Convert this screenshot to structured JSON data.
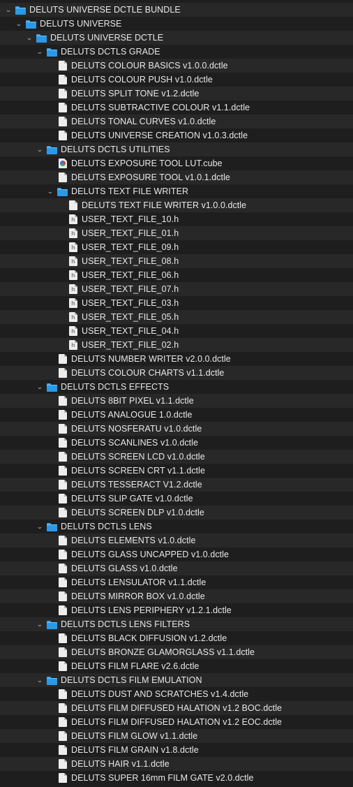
{
  "tree": [
    {
      "depth": 0,
      "type": "folder",
      "expanded": true,
      "label": "DELUTS UNIVERSE DCTLE BUNDLE",
      "icon": "folder-icon"
    },
    {
      "depth": 1,
      "type": "folder",
      "expanded": true,
      "label": "DELUTS UNIVERSE",
      "icon": "folder-icon"
    },
    {
      "depth": 2,
      "type": "folder",
      "expanded": true,
      "label": "DELUTS UNIVERSE DCTLE",
      "icon": "folder-icon"
    },
    {
      "depth": 3,
      "type": "folder",
      "expanded": true,
      "label": "DELUTS DCTLS GRADE",
      "icon": "folder-icon"
    },
    {
      "depth": 4,
      "type": "doc",
      "label": "DELUTS COLOUR BASICS v1.0.0.dctle",
      "icon": "document-icon"
    },
    {
      "depth": 4,
      "type": "doc",
      "label": "DELUTS COLOUR PUSH v1.0.dctle",
      "icon": "document-icon"
    },
    {
      "depth": 4,
      "type": "doc",
      "label": "DELUTS SPLIT TONE v1.2.dctle",
      "icon": "document-icon"
    },
    {
      "depth": 4,
      "type": "doc",
      "label": "DELUTS SUBTRACTIVE COLOUR v1.1.dctle",
      "icon": "document-icon"
    },
    {
      "depth": 4,
      "type": "doc",
      "label": "DELUTS TONAL CURVES v1.0.dctle",
      "icon": "document-icon"
    },
    {
      "depth": 4,
      "type": "doc",
      "label": "DELUTS UNIVERSE CREATION v1.0.3.dctle",
      "icon": "document-icon"
    },
    {
      "depth": 3,
      "type": "folder",
      "expanded": true,
      "label": "DELUTS DCTLS UTILITIES",
      "icon": "folder-icon"
    },
    {
      "depth": 4,
      "type": "cube",
      "label": "DELUTS EXPOSURE TOOL LUT.cube",
      "icon": "lut-cube-icon"
    },
    {
      "depth": 4,
      "type": "doc",
      "label": "DELUTS EXPOSURE TOOL v1.0.1.dctle",
      "icon": "document-icon"
    },
    {
      "depth": 4,
      "type": "folder",
      "expanded": true,
      "label": "DELUTS TEXT FILE WRITER",
      "icon": "folder-icon"
    },
    {
      "depth": 5,
      "type": "doc",
      "label": "DELUTS TEXT FILE WRITER v1.0.0.dctle",
      "icon": "document-icon"
    },
    {
      "depth": 5,
      "type": "header",
      "label": "USER_TEXT_FILE_10.h",
      "icon": "header-file-icon"
    },
    {
      "depth": 5,
      "type": "header",
      "label": "USER_TEXT_FILE_01.h",
      "icon": "header-file-icon"
    },
    {
      "depth": 5,
      "type": "header",
      "label": "USER_TEXT_FILE_09.h",
      "icon": "header-file-icon"
    },
    {
      "depth": 5,
      "type": "header",
      "label": "USER_TEXT_FILE_08.h",
      "icon": "header-file-icon"
    },
    {
      "depth": 5,
      "type": "header",
      "label": "USER_TEXT_FILE_06.h",
      "icon": "header-file-icon"
    },
    {
      "depth": 5,
      "type": "header",
      "label": "USER_TEXT_FILE_07.h",
      "icon": "header-file-icon"
    },
    {
      "depth": 5,
      "type": "header",
      "label": "USER_TEXT_FILE_03.h",
      "icon": "header-file-icon"
    },
    {
      "depth": 5,
      "type": "header",
      "label": "USER_TEXT_FILE_05.h",
      "icon": "header-file-icon"
    },
    {
      "depth": 5,
      "type": "header",
      "label": "USER_TEXT_FILE_04.h",
      "icon": "header-file-icon"
    },
    {
      "depth": 5,
      "type": "header",
      "label": "USER_TEXT_FILE_02.h",
      "icon": "header-file-icon"
    },
    {
      "depth": 4,
      "type": "doc",
      "label": "DELUTS NUMBER WRITER v2.0.0.dctle",
      "icon": "document-icon"
    },
    {
      "depth": 4,
      "type": "doc",
      "label": "DELUTS COLOUR CHARTS v1.1.dctle",
      "icon": "document-icon"
    },
    {
      "depth": 3,
      "type": "folder",
      "expanded": true,
      "label": "DELUTS DCTLS EFFECTS",
      "icon": "folder-icon"
    },
    {
      "depth": 4,
      "type": "doc",
      "label": "DELUTS 8BIT PIXEL v1.1.dctle",
      "icon": "document-icon"
    },
    {
      "depth": 4,
      "type": "doc",
      "label": "DELUTS ANALOGUE 1.0.dctle",
      "icon": "document-icon"
    },
    {
      "depth": 4,
      "type": "doc",
      "label": "DELUTS NOSFERATU v1.0.dctle",
      "icon": "document-icon"
    },
    {
      "depth": 4,
      "type": "doc",
      "label": "DELUTS SCANLINES v1.0.dctle",
      "icon": "document-icon"
    },
    {
      "depth": 4,
      "type": "doc",
      "label": "DELUTS SCREEN LCD v1.0.dctle",
      "icon": "document-icon"
    },
    {
      "depth": 4,
      "type": "doc",
      "label": "DELUTS SCREEN CRT v1.1.dctle",
      "icon": "document-icon"
    },
    {
      "depth": 4,
      "type": "doc",
      "label": "DELUTS TESSERACT V1.2.dctle",
      "icon": "document-icon"
    },
    {
      "depth": 4,
      "type": "doc",
      "label": "DELUTS SLIP GATE v1.0.dctle",
      "icon": "document-icon"
    },
    {
      "depth": 4,
      "type": "doc",
      "label": "DELUTS SCREEN DLP v1.0.dctle",
      "icon": "document-icon"
    },
    {
      "depth": 3,
      "type": "folder",
      "expanded": true,
      "label": "DELUTS DCTLS LENS",
      "icon": "folder-icon"
    },
    {
      "depth": 4,
      "type": "doc",
      "label": "DELUTS ELEMENTS v1.0.dctle",
      "icon": "document-icon"
    },
    {
      "depth": 4,
      "type": "doc",
      "label": "DELUTS GLASS UNCAPPED v1.0.dctle",
      "icon": "document-icon"
    },
    {
      "depth": 4,
      "type": "doc",
      "label": "DELUTS GLASS v1.0.dctle",
      "icon": "document-icon"
    },
    {
      "depth": 4,
      "type": "doc",
      "label": "DELUTS LENSULATOR v1.1.dctle",
      "icon": "document-icon"
    },
    {
      "depth": 4,
      "type": "doc",
      "label": "DELUTS MIRROR BOX v1.0.dctle",
      "icon": "document-icon"
    },
    {
      "depth": 4,
      "type": "doc",
      "label": "DELUTS LENS PERIPHERY v1.2.1.dctle",
      "icon": "document-icon"
    },
    {
      "depth": 3,
      "type": "folder",
      "expanded": true,
      "label": "DELUTS DCTLS LENS FILTERS",
      "icon": "folder-icon"
    },
    {
      "depth": 4,
      "type": "doc",
      "label": "DELUTS BLACK DIFFUSION v1.2.dctle",
      "icon": "document-icon"
    },
    {
      "depth": 4,
      "type": "doc",
      "label": "DELUTS BRONZE GLAMORGLASS v1.1.dctle",
      "icon": "document-icon"
    },
    {
      "depth": 4,
      "type": "doc",
      "label": "DELUTS FILM FLARE v2.6.dctle",
      "icon": "document-icon"
    },
    {
      "depth": 3,
      "type": "folder",
      "expanded": true,
      "label": "DELUTS DCTLS FILM EMULATION",
      "icon": "folder-icon"
    },
    {
      "depth": 4,
      "type": "doc",
      "label": "DELUTS DUST AND SCRATCHES v1.4.dctle",
      "icon": "document-icon"
    },
    {
      "depth": 4,
      "type": "doc",
      "label": "DELUTS FILM DIFFUSED HALATION v1.2 BOC.dctle",
      "icon": "document-icon"
    },
    {
      "depth": 4,
      "type": "doc",
      "label": "DELUTS FILM DIFFUSED HALATION v1.2 EOC.dctle",
      "icon": "document-icon"
    },
    {
      "depth": 4,
      "type": "doc",
      "label": "DELUTS FILM GLOW v1.1.dctle",
      "icon": "document-icon"
    },
    {
      "depth": 4,
      "type": "doc",
      "label": "DELUTS FILM GRAIN v1.8.dctle",
      "icon": "document-icon"
    },
    {
      "depth": 4,
      "type": "doc",
      "label": "DELUTS HAIR v1.1.dctle",
      "icon": "document-icon"
    },
    {
      "depth": 4,
      "type": "doc",
      "label": "DELUTS SUPER 16mm FILM GATE v2.0.dctle",
      "icon": "document-icon"
    }
  ],
  "chevron_glyph": "⌄",
  "colors": {
    "background": "#1e1e1e",
    "alt_row": "#282828",
    "folder": "#2a9ae8",
    "text": "#e8e8e8"
  }
}
